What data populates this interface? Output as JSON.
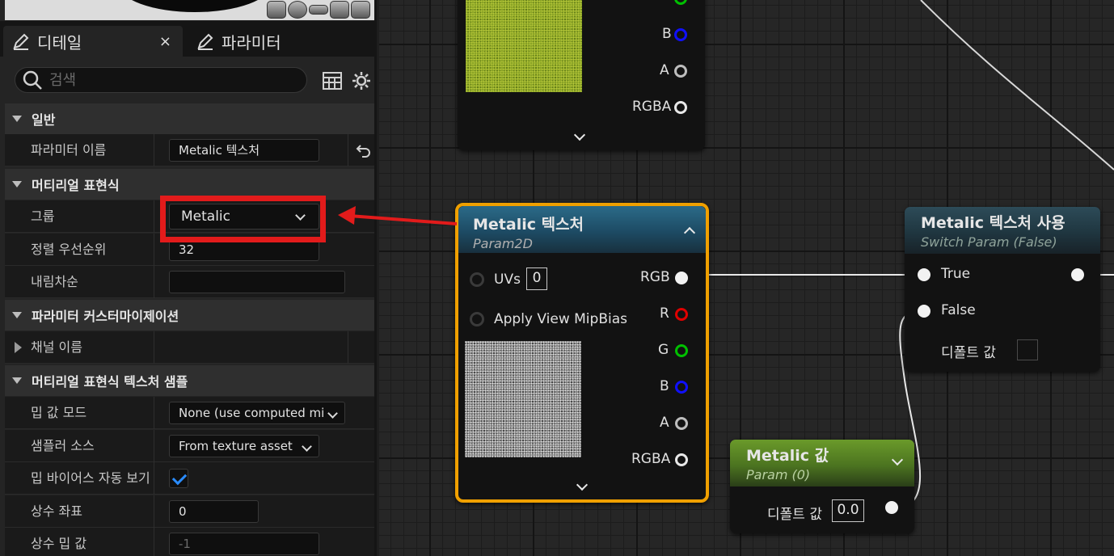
{
  "tabs": {
    "details": "디테일",
    "params": "파라미터",
    "close": "×"
  },
  "search": {
    "placeholder": "검색"
  },
  "sections": {
    "general": "일반",
    "material_expression": "머티리얼 표현식",
    "param_customization": "파라미터 커스터마이제이션",
    "tex_sample": "머티리얼 표현식 텍스처 샘플"
  },
  "rows": {
    "param_name": {
      "label": "파라미터 이름",
      "value": "Metalic 텍스처"
    },
    "group": {
      "label": "그룹",
      "value": "Metalic"
    },
    "sort_priority": {
      "label": "정렬 우선순위",
      "value": "32"
    },
    "desc": {
      "label": "내림차순",
      "value": ""
    },
    "channel_names": {
      "label": "채널 이름"
    },
    "mip_mode": {
      "label": "밉 값 모드",
      "value": "None (use computed mi"
    },
    "sampler_source": {
      "label": "샘플러 소스",
      "value": "From texture asset"
    },
    "auto_view_mip": {
      "label": "밉 바이어스 자동 보기",
      "checked": true
    },
    "const_coord": {
      "label": "상수 좌표",
      "value": "0"
    },
    "const_mip": {
      "label": "상수 밉 값",
      "value": "-1"
    }
  },
  "top_node": {
    "pins": [
      "G",
      "B",
      "A",
      "RGBA"
    ]
  },
  "tex_node": {
    "title": "Metalic 텍스처",
    "subtitle": "Param2D",
    "inputs": {
      "uvs": "UVs",
      "uvs_value": "0",
      "mip_bias": "Apply View MipBias"
    },
    "outputs": [
      "RGB",
      "R",
      "G",
      "B",
      "A",
      "RGBA"
    ]
  },
  "switch_node": {
    "title": "Metalic 텍스처 사용",
    "subtitle": "Switch Param (False)",
    "true_label": "True",
    "false_label": "False",
    "default_label": "디폴트 값"
  },
  "value_node": {
    "title": "Metalic 값",
    "subtitle": "Param (0)",
    "default_label": "디폴트 값",
    "default_value": "0.0"
  },
  "colors": {
    "highlight": "#e21b1b",
    "selection": "#f0a000",
    "pin_red": "#e00000",
    "pin_green": "#00c000",
    "pin_blue": "#1010ff",
    "check": "#2a8cff"
  }
}
